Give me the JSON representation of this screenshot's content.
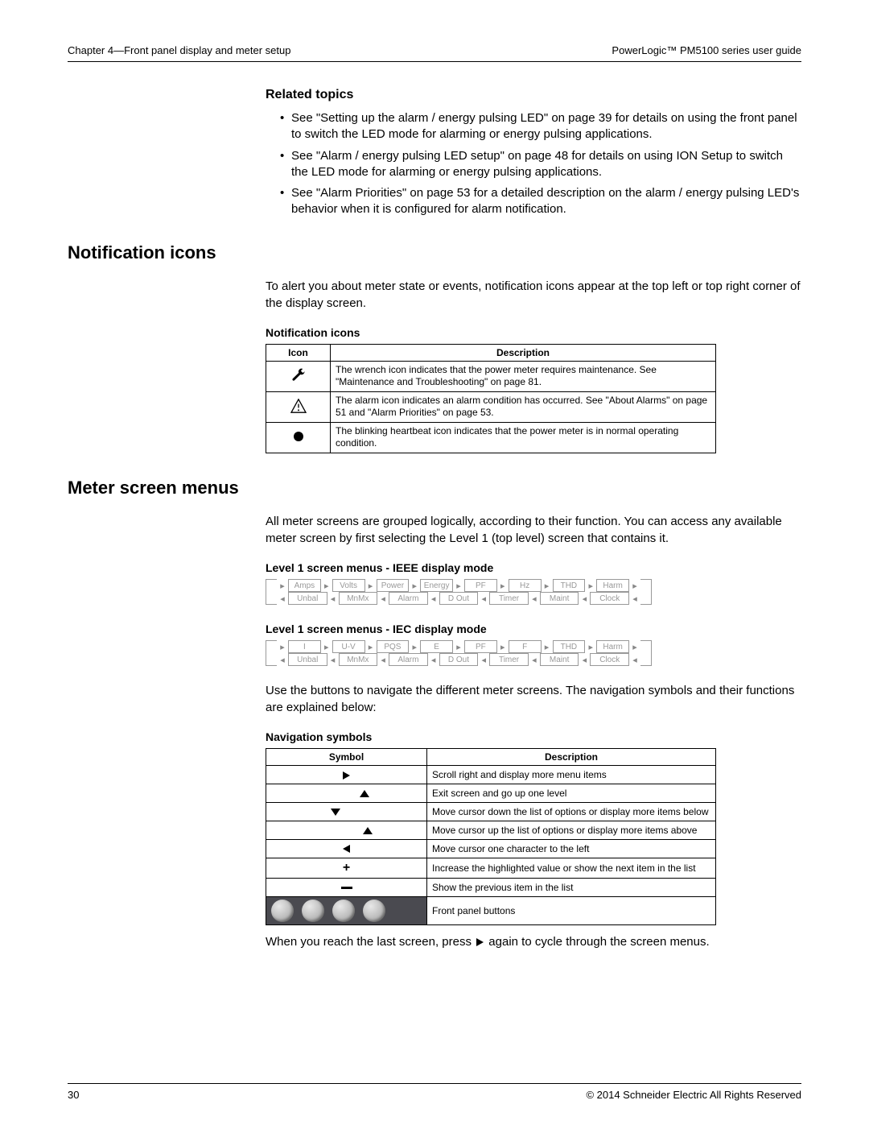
{
  "header": {
    "left": "Chapter 4—Front panel display and meter setup",
    "right": "PowerLogic™ PM5100 series user guide"
  },
  "related_topics": {
    "heading": "Related topics",
    "items": [
      "See \"Setting up the alarm / energy pulsing LED\" on page 39 for details on using the front panel to switch the LED mode for alarming or energy pulsing applications.",
      "See \"Alarm / energy pulsing LED setup\" on page 48 for details on using ION Setup to switch the LED mode for alarming or energy pulsing applications.",
      "See \"Alarm Priorities\" on page 53 for a detailed description on the alarm / energy pulsing LED's behavior when it is configured for alarm notification."
    ]
  },
  "notification": {
    "heading": "Notification icons",
    "intro": "To alert you about meter state or events, notification icons appear at the top left or top right corner of the display screen.",
    "table_caption": "Notification icons",
    "th_icon": "Icon",
    "th_desc": "Description",
    "rows": [
      {
        "icon": "wrench-icon",
        "desc": "The wrench icon indicates that the power meter requires maintenance. See \"Maintenance and Troubleshooting\" on page 81."
      },
      {
        "icon": "alarm-triangle-icon",
        "desc": "The alarm icon indicates an alarm condition has occurred. See \"About Alarms\" on page 51 and \"Alarm Priorities\" on page 53."
      },
      {
        "icon": "heartbeat-dot-icon",
        "desc": "The blinking heartbeat icon indicates that the power meter is in normal operating condition."
      }
    ]
  },
  "meter_menus": {
    "heading": "Meter screen menus",
    "intro": "All meter screens are grouped logically, according to their function. You can access any available meter screen by first selecting the Level 1 (top level) screen that contains it.",
    "ieee_caption": "Level 1 screen menus - IEEE display mode",
    "ieee_top": [
      "Amps",
      "Volts",
      "Power",
      "Energy",
      "PF",
      "Hz",
      "THD",
      "Harm"
    ],
    "ieee_bottom": [
      "Clock",
      "Maint",
      "Timer",
      "D Out",
      "Alarm",
      "MnMx",
      "Unbal"
    ],
    "iec_caption": "Level 1 screen menus - IEC display mode",
    "iec_top": [
      "I",
      "U-V",
      "PQS",
      "E",
      "PF",
      "F",
      "THD",
      "Harm"
    ],
    "iec_bottom": [
      "Clock",
      "Maint",
      "Timer",
      "D Out",
      "Alarm",
      "MnMx",
      "Unbal"
    ],
    "after_diagrams": "Use the buttons to navigate the different meter screens. The navigation symbols and their functions are explained below:",
    "nav_caption": "Navigation symbols",
    "nav_th_sym": "Symbol",
    "nav_th_desc": "Description",
    "nav_rows": [
      {
        "sym": "play-right",
        "desc": "Scroll right and display more menu items"
      },
      {
        "sym": "up-exit",
        "desc": "Exit screen and go up one level"
      },
      {
        "sym": "down",
        "desc": "Move cursor down the list of options or display more items below"
      },
      {
        "sym": "up",
        "desc": "Move cursor up the list of options or display more items above"
      },
      {
        "sym": "play-left",
        "desc": "Move cursor one character to the left"
      },
      {
        "sym": "plus",
        "desc": "Increase the highlighted value or show the next item in the list"
      },
      {
        "sym": "minus",
        "desc": "Show the previous item in the list"
      },
      {
        "sym": "buttons",
        "desc": "Front panel buttons"
      }
    ],
    "closing_before": "When you reach the last screen, press ",
    "closing_after": " again to cycle through the screen menus."
  },
  "footer": {
    "page": "30",
    "copyright": "© 2014 Schneider Electric All Rights Reserved"
  }
}
